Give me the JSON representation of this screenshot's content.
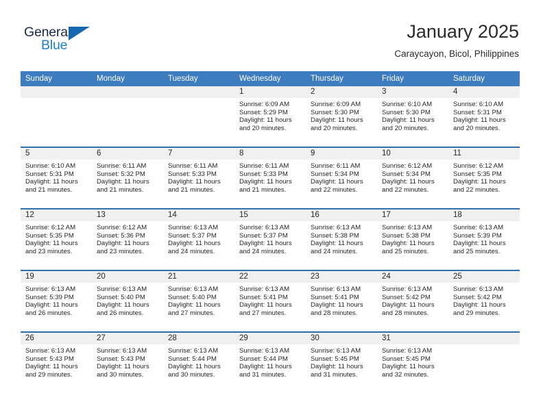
{
  "logo": {
    "word_top": "General",
    "word_bottom": "Blue",
    "triangle_icon": "triangle-icon",
    "color_top": "#1b2a44",
    "color_bottom": "#1f7fc4",
    "color_triangle": "#1668b0"
  },
  "header": {
    "title": "January 2025",
    "subtitle": "Caraycayon, Bicol, Philippines"
  },
  "theme": {
    "header_row_bg": "#3c7cbf",
    "row_divider": "#2f6fad",
    "daynum_band_bg": "#f0f0f0",
    "text": "#262626"
  },
  "weekday_headers": [
    "Sunday",
    "Monday",
    "Tuesday",
    "Wednesday",
    "Thursday",
    "Friday",
    "Saturday"
  ],
  "weeks": [
    [
      {
        "day": "",
        "sunrise": "",
        "sunset": "",
        "daylight_1": "",
        "daylight_2": "",
        "empty": true
      },
      {
        "day": "",
        "sunrise": "",
        "sunset": "",
        "daylight_1": "",
        "daylight_2": "",
        "empty": true
      },
      {
        "day": "",
        "sunrise": "",
        "sunset": "",
        "daylight_1": "",
        "daylight_2": "",
        "empty": true
      },
      {
        "day": "1",
        "sunrise": "Sunrise: 6:09 AM",
        "sunset": "Sunset: 5:29 PM",
        "daylight_1": "Daylight: 11 hours",
        "daylight_2": "and 20 minutes.",
        "empty": false
      },
      {
        "day": "2",
        "sunrise": "Sunrise: 6:09 AM",
        "sunset": "Sunset: 5:30 PM",
        "daylight_1": "Daylight: 11 hours",
        "daylight_2": "and 20 minutes.",
        "empty": false
      },
      {
        "day": "3",
        "sunrise": "Sunrise: 6:10 AM",
        "sunset": "Sunset: 5:30 PM",
        "daylight_1": "Daylight: 11 hours",
        "daylight_2": "and 20 minutes.",
        "empty": false
      },
      {
        "day": "4",
        "sunrise": "Sunrise: 6:10 AM",
        "sunset": "Sunset: 5:31 PM",
        "daylight_1": "Daylight: 11 hours",
        "daylight_2": "and 20 minutes.",
        "empty": false
      }
    ],
    [
      {
        "day": "5",
        "sunrise": "Sunrise: 6:10 AM",
        "sunset": "Sunset: 5:31 PM",
        "daylight_1": "Daylight: 11 hours",
        "daylight_2": "and 21 minutes.",
        "empty": false
      },
      {
        "day": "6",
        "sunrise": "Sunrise: 6:11 AM",
        "sunset": "Sunset: 5:32 PM",
        "daylight_1": "Daylight: 11 hours",
        "daylight_2": "and 21 minutes.",
        "empty": false
      },
      {
        "day": "7",
        "sunrise": "Sunrise: 6:11 AM",
        "sunset": "Sunset: 5:33 PM",
        "daylight_1": "Daylight: 11 hours",
        "daylight_2": "and 21 minutes.",
        "empty": false
      },
      {
        "day": "8",
        "sunrise": "Sunrise: 6:11 AM",
        "sunset": "Sunset: 5:33 PM",
        "daylight_1": "Daylight: 11 hours",
        "daylight_2": "and 21 minutes.",
        "empty": false
      },
      {
        "day": "9",
        "sunrise": "Sunrise: 6:11 AM",
        "sunset": "Sunset: 5:34 PM",
        "daylight_1": "Daylight: 11 hours",
        "daylight_2": "and 22 minutes.",
        "empty": false
      },
      {
        "day": "10",
        "sunrise": "Sunrise: 6:12 AM",
        "sunset": "Sunset: 5:34 PM",
        "daylight_1": "Daylight: 11 hours",
        "daylight_2": "and 22 minutes.",
        "empty": false
      },
      {
        "day": "11",
        "sunrise": "Sunrise: 6:12 AM",
        "sunset": "Sunset: 5:35 PM",
        "daylight_1": "Daylight: 11 hours",
        "daylight_2": "and 22 minutes.",
        "empty": false
      }
    ],
    [
      {
        "day": "12",
        "sunrise": "Sunrise: 6:12 AM",
        "sunset": "Sunset: 5:35 PM",
        "daylight_1": "Daylight: 11 hours",
        "daylight_2": "and 23 minutes.",
        "empty": false
      },
      {
        "day": "13",
        "sunrise": "Sunrise: 6:12 AM",
        "sunset": "Sunset: 5:36 PM",
        "daylight_1": "Daylight: 11 hours",
        "daylight_2": "and 23 minutes.",
        "empty": false
      },
      {
        "day": "14",
        "sunrise": "Sunrise: 6:13 AM",
        "sunset": "Sunset: 5:37 PM",
        "daylight_1": "Daylight: 11 hours",
        "daylight_2": "and 24 minutes.",
        "empty": false
      },
      {
        "day": "15",
        "sunrise": "Sunrise: 6:13 AM",
        "sunset": "Sunset: 5:37 PM",
        "daylight_1": "Daylight: 11 hours",
        "daylight_2": "and 24 minutes.",
        "empty": false
      },
      {
        "day": "16",
        "sunrise": "Sunrise: 6:13 AM",
        "sunset": "Sunset: 5:38 PM",
        "daylight_1": "Daylight: 11 hours",
        "daylight_2": "and 24 minutes.",
        "empty": false
      },
      {
        "day": "17",
        "sunrise": "Sunrise: 6:13 AM",
        "sunset": "Sunset: 5:38 PM",
        "daylight_1": "Daylight: 11 hours",
        "daylight_2": "and 25 minutes.",
        "empty": false
      },
      {
        "day": "18",
        "sunrise": "Sunrise: 6:13 AM",
        "sunset": "Sunset: 5:39 PM",
        "daylight_1": "Daylight: 11 hours",
        "daylight_2": "and 25 minutes.",
        "empty": false
      }
    ],
    [
      {
        "day": "19",
        "sunrise": "Sunrise: 6:13 AM",
        "sunset": "Sunset: 5:39 PM",
        "daylight_1": "Daylight: 11 hours",
        "daylight_2": "and 26 minutes.",
        "empty": false
      },
      {
        "day": "20",
        "sunrise": "Sunrise: 6:13 AM",
        "sunset": "Sunset: 5:40 PM",
        "daylight_1": "Daylight: 11 hours",
        "daylight_2": "and 26 minutes.",
        "empty": false
      },
      {
        "day": "21",
        "sunrise": "Sunrise: 6:13 AM",
        "sunset": "Sunset: 5:40 PM",
        "daylight_1": "Daylight: 11 hours",
        "daylight_2": "and 27 minutes.",
        "empty": false
      },
      {
        "day": "22",
        "sunrise": "Sunrise: 6:13 AM",
        "sunset": "Sunset: 5:41 PM",
        "daylight_1": "Daylight: 11 hours",
        "daylight_2": "and 27 minutes.",
        "empty": false
      },
      {
        "day": "23",
        "sunrise": "Sunrise: 6:13 AM",
        "sunset": "Sunset: 5:41 PM",
        "daylight_1": "Daylight: 11 hours",
        "daylight_2": "and 28 minutes.",
        "empty": false
      },
      {
        "day": "24",
        "sunrise": "Sunrise: 6:13 AM",
        "sunset": "Sunset: 5:42 PM",
        "daylight_1": "Daylight: 11 hours",
        "daylight_2": "and 28 minutes.",
        "empty": false
      },
      {
        "day": "25",
        "sunrise": "Sunrise: 6:13 AM",
        "sunset": "Sunset: 5:42 PM",
        "daylight_1": "Daylight: 11 hours",
        "daylight_2": "and 29 minutes.",
        "empty": false
      }
    ],
    [
      {
        "day": "26",
        "sunrise": "Sunrise: 6:13 AM",
        "sunset": "Sunset: 5:43 PM",
        "daylight_1": "Daylight: 11 hours",
        "daylight_2": "and 29 minutes.",
        "empty": false
      },
      {
        "day": "27",
        "sunrise": "Sunrise: 6:13 AM",
        "sunset": "Sunset: 5:43 PM",
        "daylight_1": "Daylight: 11 hours",
        "daylight_2": "and 30 minutes.",
        "empty": false
      },
      {
        "day": "28",
        "sunrise": "Sunrise: 6:13 AM",
        "sunset": "Sunset: 5:44 PM",
        "daylight_1": "Daylight: 11 hours",
        "daylight_2": "and 30 minutes.",
        "empty": false
      },
      {
        "day": "29",
        "sunrise": "Sunrise: 6:13 AM",
        "sunset": "Sunset: 5:44 PM",
        "daylight_1": "Daylight: 11 hours",
        "daylight_2": "and 31 minutes.",
        "empty": false
      },
      {
        "day": "30",
        "sunrise": "Sunrise: 6:13 AM",
        "sunset": "Sunset: 5:45 PM",
        "daylight_1": "Daylight: 11 hours",
        "daylight_2": "and 31 minutes.",
        "empty": false
      },
      {
        "day": "31",
        "sunrise": "Sunrise: 6:13 AM",
        "sunset": "Sunset: 5:45 PM",
        "daylight_1": "Daylight: 11 hours",
        "daylight_2": "and 32 minutes.",
        "empty": false
      },
      {
        "day": "",
        "sunrise": "",
        "sunset": "",
        "daylight_1": "",
        "daylight_2": "",
        "empty": true
      }
    ]
  ]
}
